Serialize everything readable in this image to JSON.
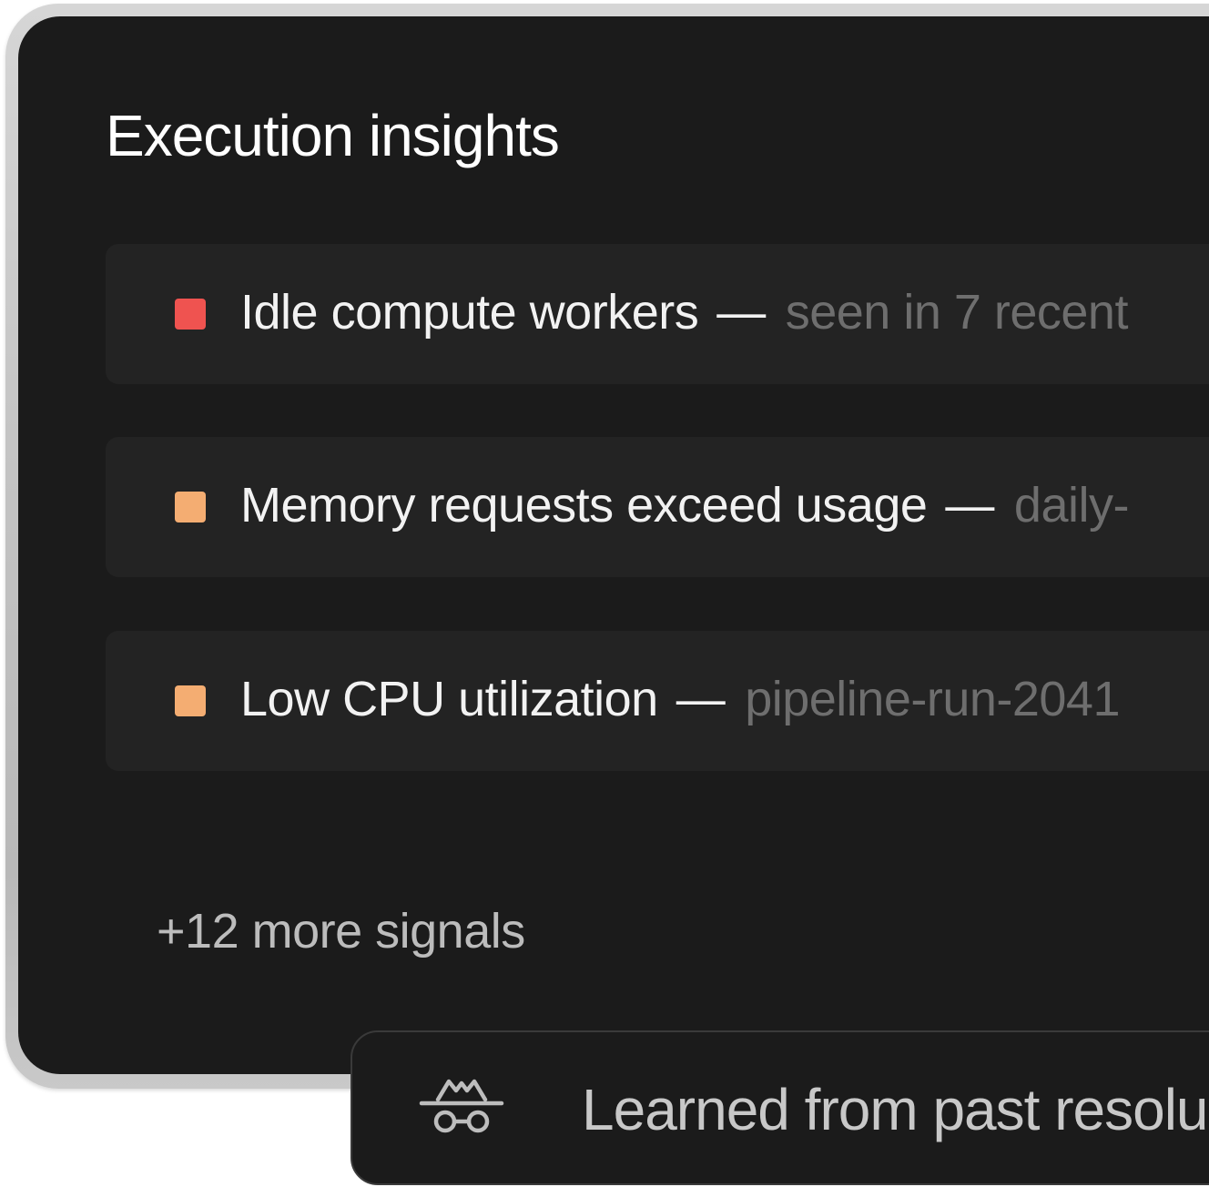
{
  "panel": {
    "title": "Execution insights",
    "signals": [
      {
        "label": "Idle compute workers",
        "separator": "—",
        "detail": "seen in 7 recent",
        "severity_color": "#ef5350"
      },
      {
        "label": "Memory requests exceed usage",
        "separator": "—",
        "detail": "daily-",
        "severity_color": "#f4ad72"
      },
      {
        "label": "Low CPU utilization",
        "separator": "—",
        "detail": "pipeline-run-2041",
        "severity_color": "#f4ad72"
      }
    ],
    "more_signals": "+12 more signals"
  },
  "toast": {
    "icon": "incognito-icon",
    "label": "Learned from past resolu"
  },
  "colors": {
    "background": "#1b1b1b",
    "row_background": "#232323",
    "high": "#ef5350",
    "medium": "#f4ad72"
  }
}
